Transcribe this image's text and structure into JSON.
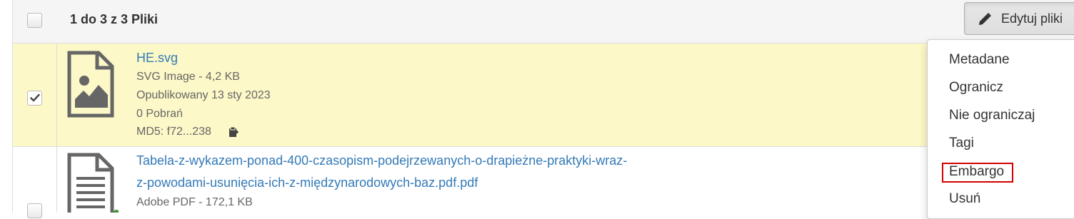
{
  "header": {
    "title": "1 do 3 z 3 Pliki",
    "edit_button_label": "Edytuj pliki"
  },
  "dropdown": {
    "items": [
      "Metadane",
      "Ogranicz",
      "Nie ograniczaj",
      "Tagi",
      "Embargo",
      "Usuń"
    ],
    "highlighted": "Embargo",
    "highlight_color": "#d40000"
  },
  "files": [
    {
      "name": "HE.svg",
      "type_size": "SVG Image - 4,2 KB",
      "published": "Opublikowany 13 sty 2023",
      "downloads": "0 Pobrań",
      "md5": "MD5: f72...238",
      "selected": true,
      "icon": "image-file-icon"
    },
    {
      "name_line1": "Tabela-z-wykazem-ponad-400-czasopism-podejrzewanych-o-drapieżne-praktyki-wraz-",
      "name_line2": "z-powodami-usunięcia-ich-z-międzynarodowych-baz.pdf.pdf",
      "type_size": "Adobe PDF - 172,1 KB",
      "selected": false,
      "icon": "document-file-icon"
    }
  ],
  "colors": {
    "link": "#337ab7",
    "selected_row": "#fcf8c7",
    "header_bg": "#f5f5f5"
  }
}
